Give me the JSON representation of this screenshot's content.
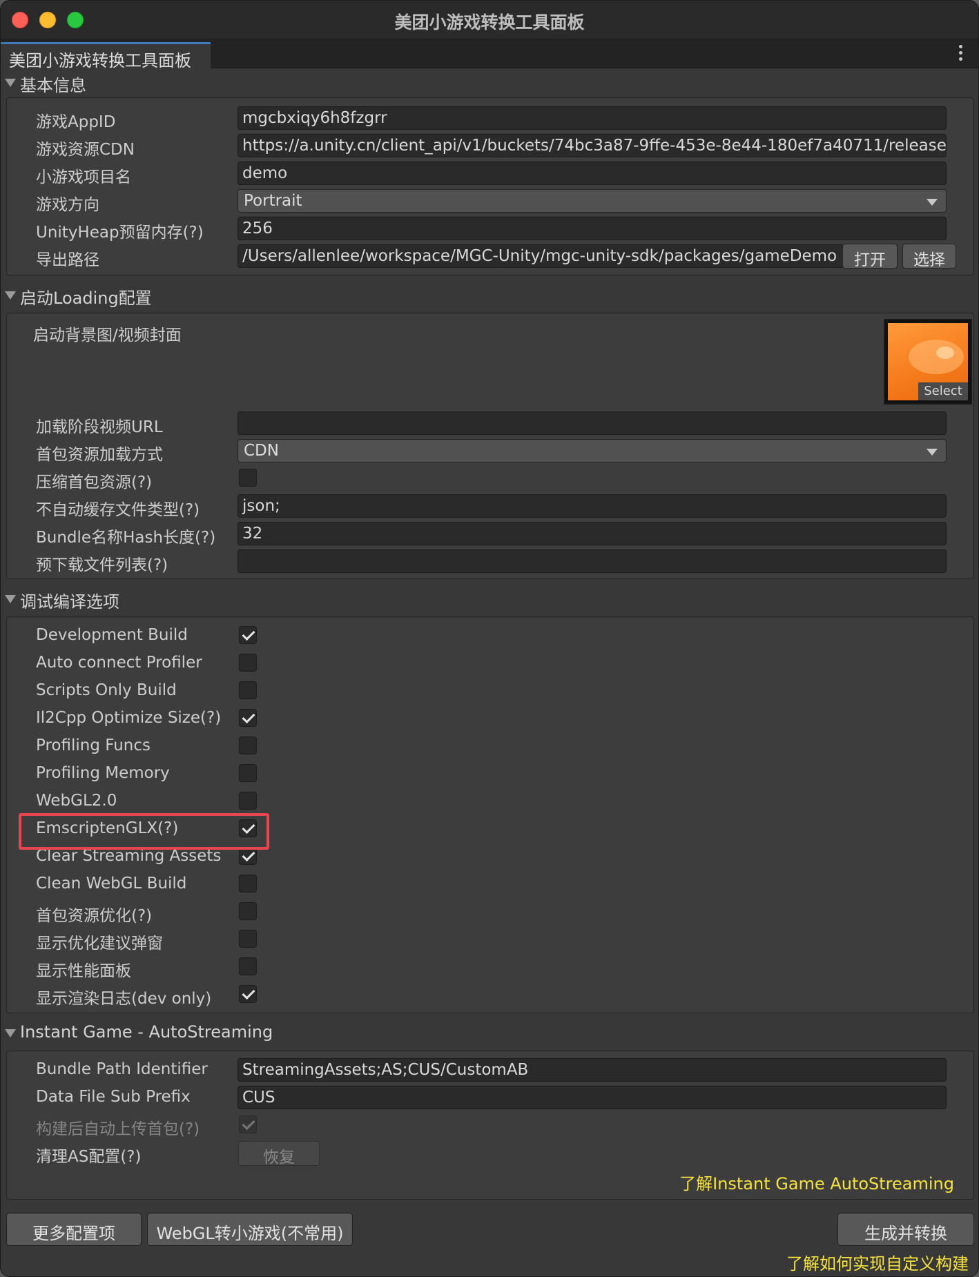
{
  "window": {
    "title": "美团小游戏转换工具面板",
    "tab_label": "美团小游戏转换工具面板"
  },
  "basic": {
    "header": "基本信息",
    "app_id_label": "游戏AppID",
    "app_id_value": "mgcbxiqy6h8fzgrr",
    "cdn_label": "游戏资源CDN",
    "cdn_value": "https://a.unity.cn/client_api/v1/buckets/74bc3a87-9ffe-453e-8e44-180ef7a40711/release",
    "project_name_label": "小游戏项目名",
    "project_name_value": "demo",
    "orientation_label": "游戏方向",
    "orientation_value": "Portrait",
    "heap_label": "UnityHeap预留内存(?)",
    "heap_value": "256",
    "export_path_label": "导出路径",
    "export_path_value": "/Users/allenlee/workspace/MGC-Unity/mgc-unity-sdk/packages/gameDemo",
    "open_button": "打开",
    "choose_button": "选择"
  },
  "loading": {
    "header": "启动Loading配置",
    "bg_label": "启动背景图/视频封面",
    "select_label": "Select",
    "video_url_label": "加载阶段视频URL",
    "video_url_value": "",
    "load_mode_label": "首包资源加载方式",
    "load_mode_value": "CDN",
    "compress_label": "压缩首包资源(?)",
    "no_cache_label": "不自动缓存文件类型(?)",
    "no_cache_value": "json;",
    "hash_len_label": "Bundle名称Hash长度(?)",
    "hash_len_value": "32",
    "preload_label": "预下载文件列表(?)",
    "preload_value": ""
  },
  "debug": {
    "header": "调试编译选项",
    "options": [
      {
        "label": "Development Build",
        "checked": true
      },
      {
        "label": "Auto connect Profiler",
        "checked": false
      },
      {
        "label": "Scripts Only Build",
        "checked": false
      },
      {
        "label": "Il2Cpp Optimize Size(?)",
        "checked": true
      },
      {
        "label": "Profiling Funcs",
        "checked": false
      },
      {
        "label": "Profiling Memory",
        "checked": false
      },
      {
        "label": "WebGL2.0",
        "checked": false
      },
      {
        "label": "EmscriptenGLX(?)",
        "checked": true
      },
      {
        "label": "Clear Streaming Assets",
        "checked": true
      },
      {
        "label": "Clean WebGL Build",
        "checked": false
      },
      {
        "label": "首包资源优化(?)",
        "checked": false
      },
      {
        "label": "显示优化建议弹窗",
        "checked": false
      },
      {
        "label": "显示性能面板",
        "checked": false
      },
      {
        "label": "显示渲染日志(dev only)",
        "checked": true
      }
    ]
  },
  "instant": {
    "header": "Instant Game - AutoStreaming",
    "bundle_path_label": "Bundle Path Identifier",
    "bundle_path_value": "StreamingAssets;AS;CUS/CustomAB",
    "sub_prefix_label": "Data File Sub Prefix",
    "sub_prefix_value": "CUS",
    "auto_upload_label": "构建后自动上传首包(?)",
    "auto_upload_checked": true,
    "clear_as_label": "清理AS配置(?)",
    "restore_button": "恢复",
    "learn_link": "了解Instant Game AutoStreaming"
  },
  "footer": {
    "more_config": "更多配置项",
    "webgl_convert": "WebGL转小游戏(不常用)",
    "generate_convert": "生成并转换",
    "custom_build_link": "了解如何实现自定义构建"
  }
}
